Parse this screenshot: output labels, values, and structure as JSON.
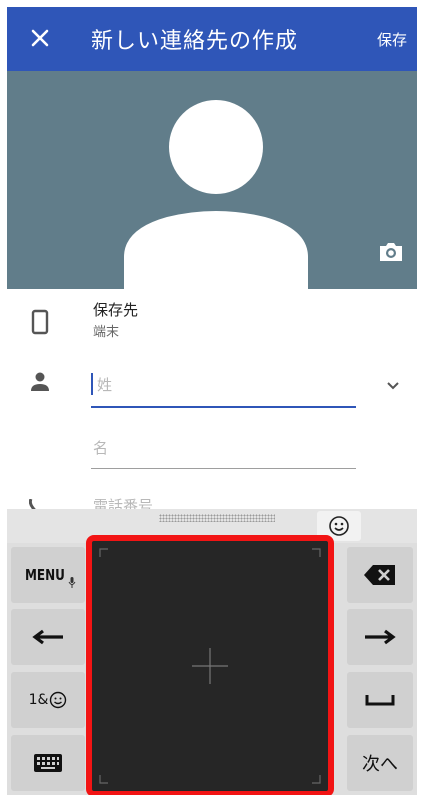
{
  "appbar": {
    "title": "新しい連絡先の作成",
    "save_label": "保存"
  },
  "account": {
    "label": "保存先",
    "value": "端末"
  },
  "name_fields": {
    "last_placeholder": "姓",
    "first_placeholder": "名"
  },
  "phone_field": {
    "placeholder": "電話番号"
  },
  "keyboard": {
    "menu_label": "MENU",
    "symbols_label": "1&",
    "next_label": "次へ"
  },
  "colors": {
    "appbar": "#2f56b8",
    "hero": "#617d8a",
    "accent": "#2f56b8",
    "highlight": "#f21414"
  }
}
